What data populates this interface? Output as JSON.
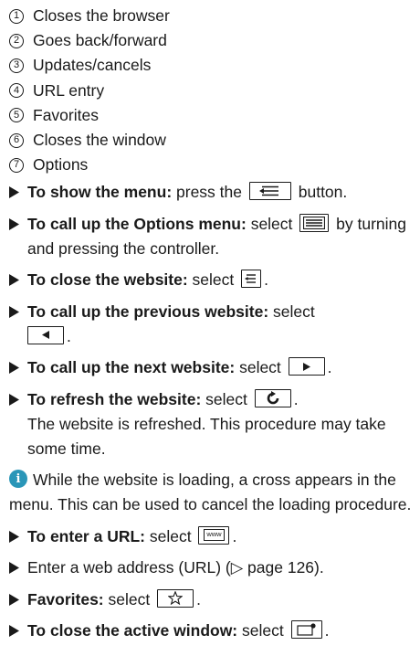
{
  "legend": [
    {
      "num": "1",
      "text": "Closes the browser"
    },
    {
      "num": "2",
      "text": "Goes back/forward"
    },
    {
      "num": "3",
      "text": "Updates/cancels"
    },
    {
      "num": "4",
      "text": "URL entry"
    },
    {
      "num": "5",
      "text": "Favorites"
    },
    {
      "num": "6",
      "text": "Closes the window"
    },
    {
      "num": "7",
      "text": "Options"
    }
  ],
  "steps": {
    "show_menu": {
      "bold": "To show the menu:",
      "pre": " press the ",
      "post": " button."
    },
    "options_menu": {
      "bold": "To call up the Options menu:",
      "pre": " select ",
      "post": " by turning and pressing the controller."
    },
    "close_website": {
      "bold": "To close the website:",
      "pre": " select ",
      "post": "."
    },
    "previous_website": {
      "bold": "To call up the previous website:",
      "pre": " select ",
      "post": "."
    },
    "next_website": {
      "bold": "To call up the next website:",
      "pre": " select ",
      "post": "."
    },
    "refresh_website": {
      "bold": "To refresh the website:",
      "pre": " select ",
      "post": ".",
      "followup": "The website is refreshed. This procedure may take some time."
    },
    "enter_url": {
      "bold": "To enter a URL:",
      "pre": " select ",
      "post": "."
    },
    "enter_address": {
      "text": "Enter a web address (URL) (▷ page 126)."
    },
    "favorites": {
      "bold": "Favorites:",
      "pre": " select ",
      "post": "."
    },
    "close_window": {
      "bold": "To close the active window:",
      "pre": " select ",
      "post": "."
    }
  },
  "note": {
    "icon_label": "i",
    "text": "While the website is loading, a cross appears in the menu. This can be used to cancel the loading procedure."
  },
  "icons": {
    "www_label": "www"
  },
  "colors": {
    "info_icon": "#2a96b8",
    "text": "#1a1a1a"
  }
}
